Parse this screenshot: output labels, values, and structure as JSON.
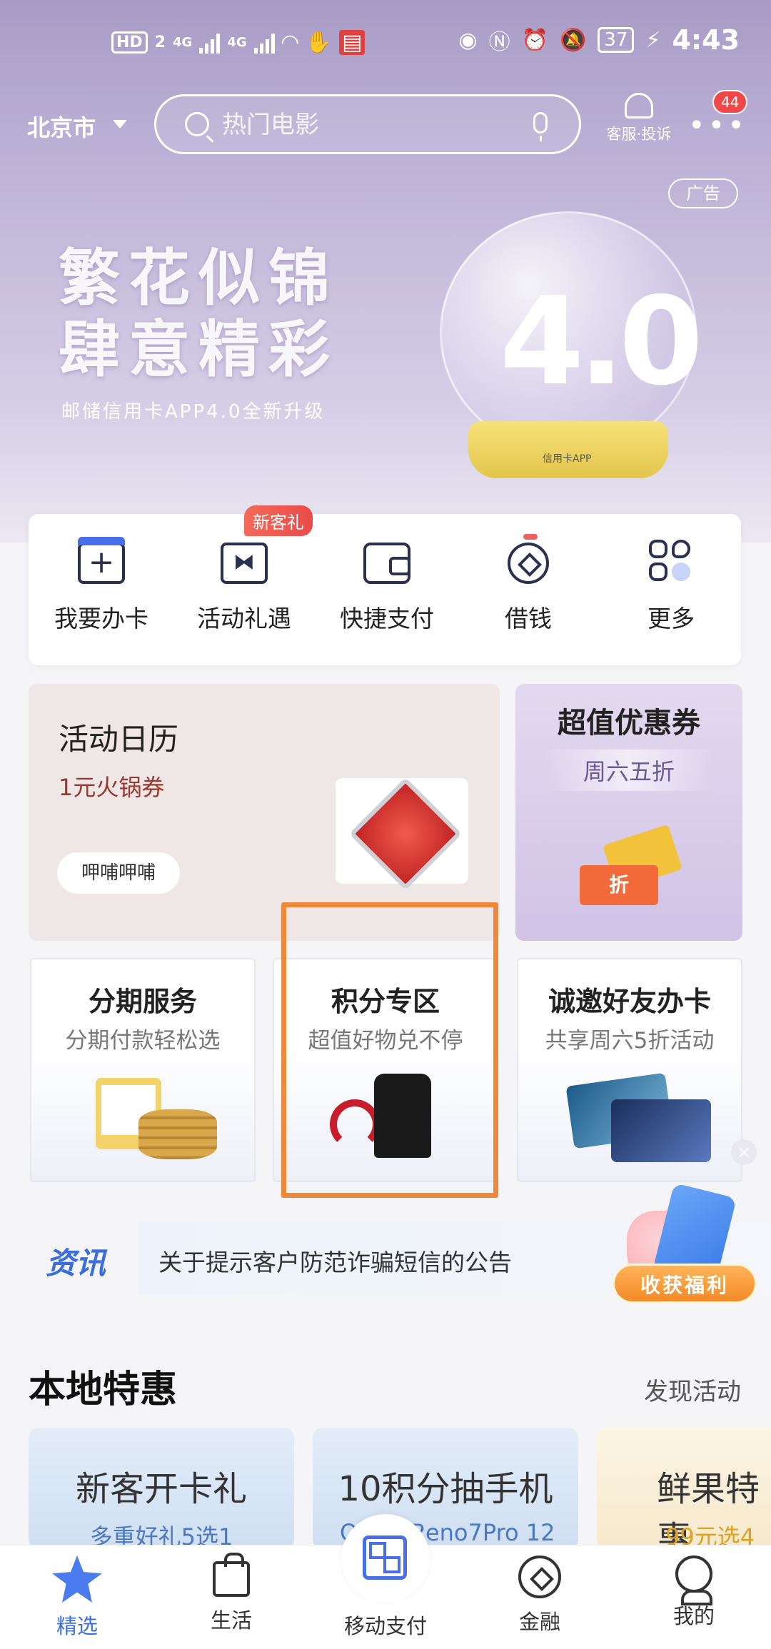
{
  "status": {
    "left_icons": [
      "HD",
      "2",
      "4G",
      "4G",
      "wifi-icon",
      "hand-icon",
      "book-icon"
    ],
    "hd_label": "HD",
    "sim_label": "2",
    "net1": "4G",
    "net2": "4G",
    "battery": "37",
    "time": "4:43"
  },
  "header": {
    "city": "北京市",
    "search_placeholder": "热门电影",
    "service_label": "客服·投诉",
    "badge_count": "44"
  },
  "banner": {
    "ad_tag": "广告",
    "line1": "繁花似锦",
    "line2": "肆意精彩",
    "subtitle": "邮储信用卡APP4.0全新升级",
    "globe_number": "4.0",
    "globe_label": "信用卡APP"
  },
  "quick_actions": [
    {
      "label": "我要办卡",
      "icon": "card-icon"
    },
    {
      "label": "活动礼遇",
      "icon": "gift-icon",
      "badge": "新客礼"
    },
    {
      "label": "快捷支付",
      "icon": "wallet-icon"
    },
    {
      "label": "借钱",
      "icon": "coin-icon"
    },
    {
      "label": "更多",
      "icon": "grid-icon"
    }
  ],
  "calendar": {
    "title": "活动日历",
    "subtitle": "1元火锅券",
    "button": "呷哺呷哺"
  },
  "coupon": {
    "title": "超值优惠券",
    "subtitle": "周六五折",
    "ticket_text": "折"
  },
  "tiles": [
    {
      "title": "分期服务",
      "subtitle": "分期付款轻松选"
    },
    {
      "title": "积分专区",
      "subtitle": "超值好物兑不停"
    },
    {
      "title": "诚邀好友办卡",
      "subtitle": "共享周六5折活动"
    }
  ],
  "news": {
    "logo": "资讯",
    "headline": "关于提示客户防范诈骗短信的公告",
    "welfare_button": "收获福利"
  },
  "local": {
    "title": "本地特惠",
    "link": "发现活动",
    "promos": [
      {
        "title": "新客开卡礼",
        "subtitle": "多重好礼5选1"
      },
      {
        "title": "10积分抽手机",
        "subtitle": "OPPO Reno7Pro 12"
      },
      {
        "title": "鲜果特惠",
        "subtitle": "99元选4"
      }
    ]
  },
  "tabbar": [
    {
      "label": "精选",
      "icon": "star-icon",
      "active": true
    },
    {
      "label": "生活",
      "icon": "bag-icon"
    },
    {
      "label": "移动支付",
      "icon": "qr-icon"
    },
    {
      "label": "金融",
      "icon": "finance-icon"
    },
    {
      "label": "我的",
      "icon": "me-icon"
    }
  ],
  "colors": {
    "accent": "#3a6ee0",
    "highlight": "#f0883a",
    "badge": "#f04848"
  }
}
